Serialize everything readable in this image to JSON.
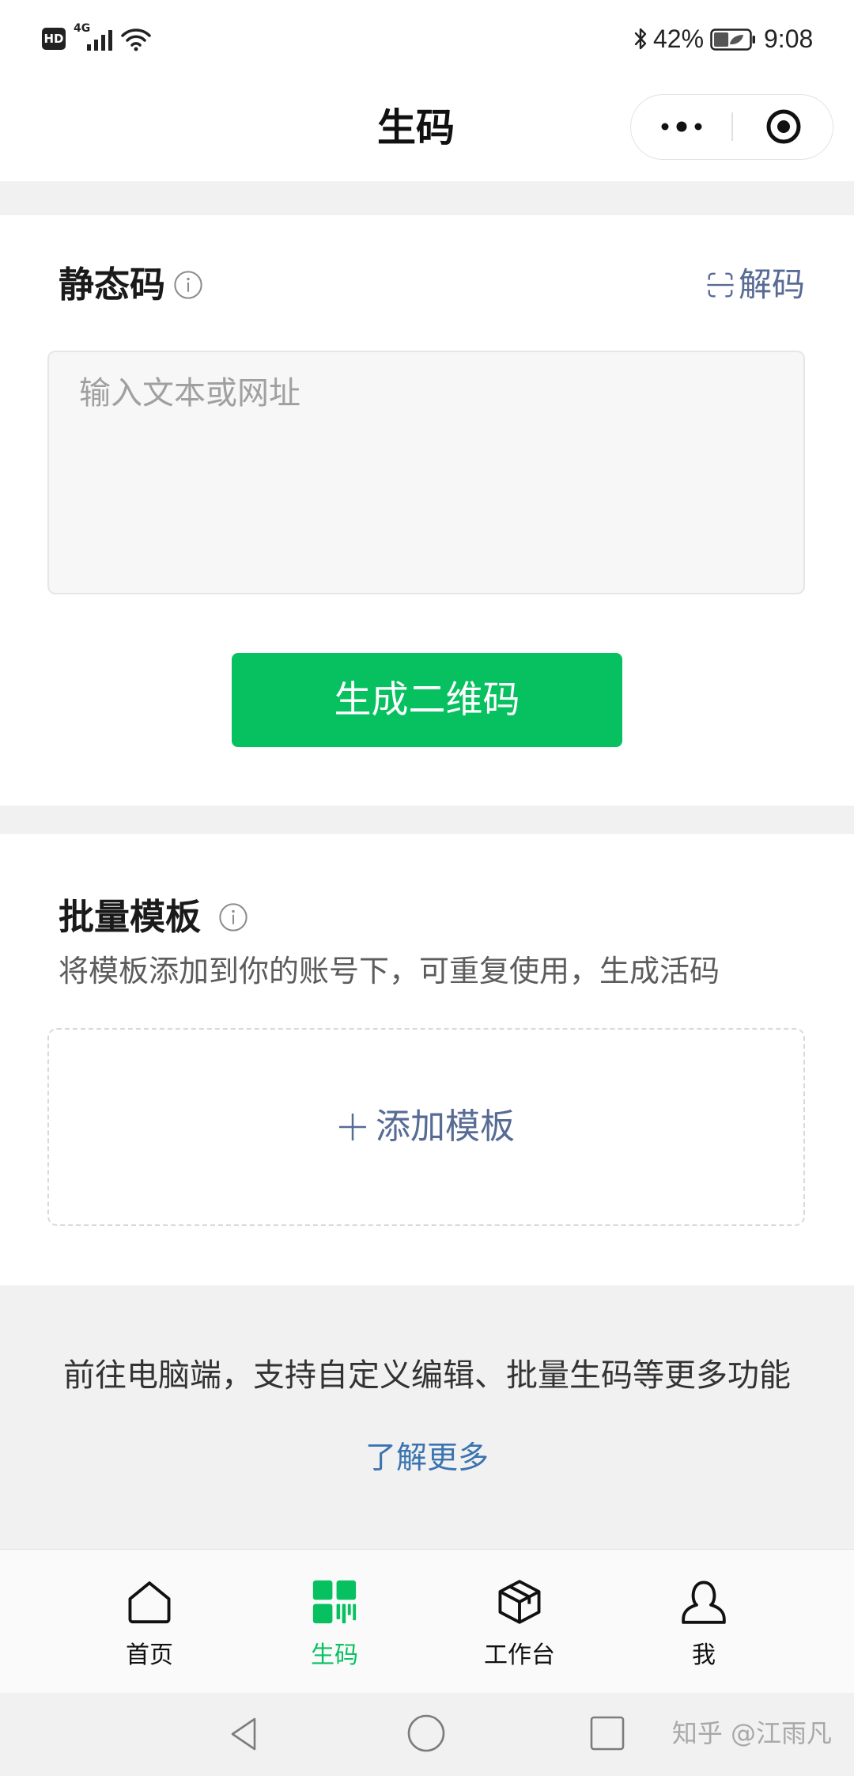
{
  "status_bar": {
    "hd_badge": "HD",
    "network": "4G",
    "signal_icon": "cellular-signal-icon",
    "wifi_icon": "wifi-icon",
    "bluetooth_icon": "bluetooth-icon",
    "battery_percent": "42%",
    "battery_level": 42,
    "time": "9:08"
  },
  "nav_bar": {
    "title": "生码",
    "capsule": {
      "more_icon": "more-dots-icon",
      "close_icon": "target-circle-icon"
    }
  },
  "static_code": {
    "title": "静态码",
    "info_icon": "info-icon",
    "decode": {
      "icon": "scan-icon",
      "label": "解码"
    },
    "input": {
      "placeholder": "输入文本或网址",
      "value": ""
    },
    "generate_button": "生成二维码"
  },
  "batch_template": {
    "title": "批量模板",
    "info_icon": "info-icon",
    "subtitle": "将模板添加到你的账号下，可重复使用，生成活码",
    "add": {
      "icon": "plus-icon",
      "label": "添加模板"
    }
  },
  "desktop_promo": {
    "text": "前往电脑端，支持自定义编辑、批量生码等更多功能",
    "link": "了解更多"
  },
  "tab_bar": {
    "items": [
      {
        "label": "首页",
        "icon": "home-icon",
        "active": false
      },
      {
        "label": "生码",
        "icon": "qr-code-icon",
        "active": true
      },
      {
        "label": "工作台",
        "icon": "workbench-box-icon",
        "active": false
      },
      {
        "label": "我",
        "icon": "profile-icon",
        "active": false
      }
    ]
  },
  "system_nav": {
    "back_icon": "back-triangle-icon",
    "home_icon": "home-circle-icon",
    "recents_icon": "recents-square-icon"
  },
  "watermark": "知乎 @江雨凡",
  "colors": {
    "accent": "#07c160",
    "link": "#576b95",
    "page_background": "#f1f1f1",
    "text": "#111111"
  }
}
